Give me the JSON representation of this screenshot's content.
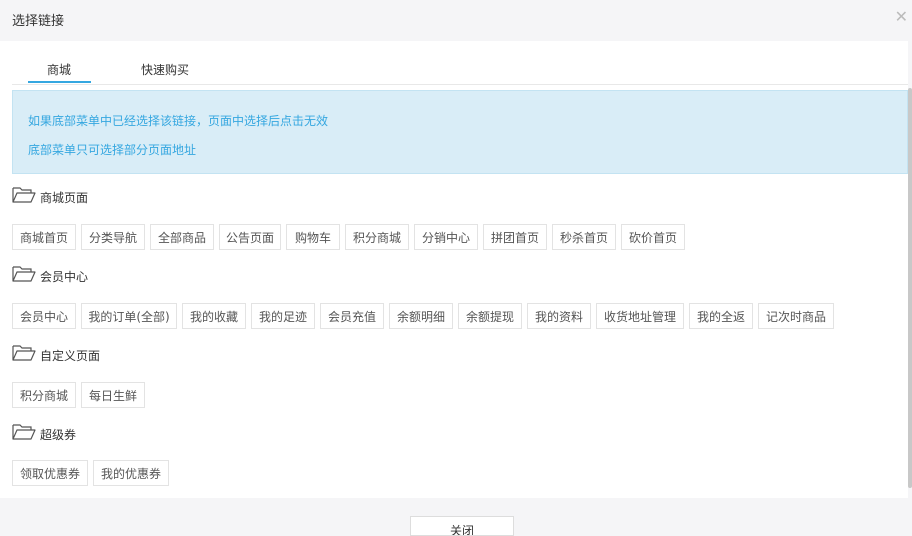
{
  "dialog": {
    "title": "选择链接",
    "close_icon": "close-icon"
  },
  "tabs": [
    "商城",
    "快速购买"
  ],
  "notice": {
    "line1": "如果底部菜单中已经选择该链接，页面中选择后点击无效",
    "line2": "底部菜单只可选择部分页面地址"
  },
  "sections": [
    {
      "title": "商城页面",
      "items": [
        "商城首页",
        "分类导航",
        "全部商品",
        "公告页面",
        "购物车",
        "积分商城",
        "分销中心",
        "拼团首页",
        "秒杀首页",
        "砍价首页"
      ]
    },
    {
      "title": "会员中心",
      "items": [
        "会员中心",
        "我的订单(全部)",
        "我的收藏",
        "我的足迹",
        "会员充值",
        "余额明细",
        "余额提现",
        "我的资料",
        "收货地址管理",
        "我的全返",
        "记次时商品"
      ]
    },
    {
      "title": "自定义页面",
      "items": [
        "积分商城",
        "每日生鲜"
      ]
    },
    {
      "title": "超级券",
      "items": [
        "领取优惠券",
        "我的优惠券"
      ]
    }
  ],
  "footer": {
    "button_label": "关闭"
  },
  "colors": {
    "accent": "#35a7e0",
    "notice_bg": "#d9edf7"
  }
}
